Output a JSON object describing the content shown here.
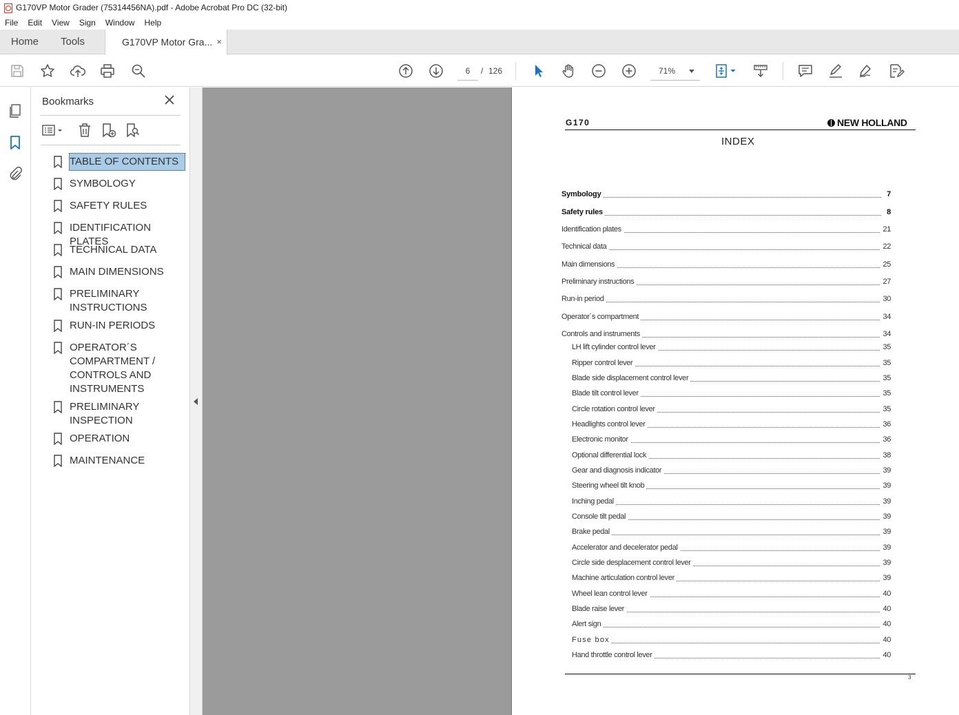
{
  "window": {
    "title": "G170VP Motor Grader (75314456NA).pdf - Adobe Acrobat Pro DC (32-bit)"
  },
  "menu": {
    "items": [
      "File",
      "Edit",
      "View",
      "Sign",
      "Window",
      "Help"
    ]
  },
  "tabs": {
    "home": "Home",
    "tools": "Tools",
    "document": "G170VP Motor Gra...",
    "close_glyph": "×"
  },
  "toolbar": {
    "page_current": "6",
    "page_separator": "/",
    "page_total": "126",
    "zoom": "71%",
    "icons": [
      "save-icon",
      "star-icon",
      "upload-icon",
      "print-icon",
      "search-zoom-icon",
      "page-up-icon",
      "page-down-icon",
      "select-arrow-icon",
      "hand-icon",
      "zoom-out-icon",
      "zoom-in-icon",
      "fit-page-icon",
      "scroll-mode-icon",
      "comment-icon",
      "highlight-icon",
      "sign-icon",
      "edit-pdf-icon"
    ]
  },
  "sidebar": {
    "panel_title": "Bookmarks",
    "close_glyph": "✕",
    "bookmarks": [
      {
        "label": "TABLE OF CONTENTS",
        "selected": true
      },
      {
        "label": "SYMBOLOGY"
      },
      {
        "label": "SAFETY RULES"
      },
      {
        "label": "IDENTIFICATION PLATES"
      },
      {
        "label": "TECHNICAL DATA"
      },
      {
        "label": "MAIN DIMENSIONS"
      },
      {
        "label": "PRELIMINARY INSTRUCTIONS"
      },
      {
        "label": "RUN-IN PERIODS"
      },
      {
        "label": "OPERATOR´S COMPARTMENT / CONTROLS AND INSTRUMENTS"
      },
      {
        "label": "PRELIMINARY INSPECTION"
      },
      {
        "label": "OPERATION"
      },
      {
        "label": "MAINTENANCE"
      }
    ]
  },
  "document": {
    "header_model": "G170",
    "header_brand": "NEW HOLLAND",
    "heading": "INDEX",
    "footer_page": "3",
    "toc": [
      {
        "label": "Symbology",
        "page": "7",
        "style": "bold"
      },
      {
        "label": "Safety  rules",
        "page": "8",
        "style": "bold"
      },
      {
        "label": "Identification plates",
        "page": "21"
      },
      {
        "label": "Technical data",
        "page": "22"
      },
      {
        "label": "Main dimensions",
        "page": "25"
      },
      {
        "label": "Preliminary instructions",
        "page": "27"
      },
      {
        "label": "Run-in period",
        "page": "30"
      },
      {
        "label": "Operator´s compartment",
        "page": "34"
      },
      {
        "label": "Controls and instruments",
        "page": "34"
      },
      {
        "label": "LH lift cylinder control lever",
        "page": "35",
        "style": "sub"
      },
      {
        "label": "Ripper control lever",
        "page": "35",
        "style": "sub"
      },
      {
        "label": "Blade side displacement control lever",
        "page": "35",
        "style": "sub"
      },
      {
        "label": "Blade tilt control lever",
        "page": "35",
        "style": "sub"
      },
      {
        "label": "Circle rotation control lever",
        "page": "35",
        "style": "sub"
      },
      {
        "label": "Headlights control lever",
        "page": "36",
        "style": "sub"
      },
      {
        "label": "Electronic monitor",
        "page": "36",
        "style": "sub"
      },
      {
        "label": "Optional differential lock",
        "page": "38",
        "style": "sub"
      },
      {
        "label": "Gear and diagnosis indicator",
        "page": "39",
        "style": "sub"
      },
      {
        "label": "Steering wheel tilt knob",
        "page": "39",
        "style": "sub"
      },
      {
        "label": "Inching pedal",
        "page": "39",
        "style": "sub"
      },
      {
        "label": "Console tilt pedal",
        "page": "39",
        "style": "sub"
      },
      {
        "label": "Brake pedal",
        "page": "39",
        "style": "sub"
      },
      {
        "label": "Accelerator and decelerator pedal",
        "page": "39",
        "style": "sub"
      },
      {
        "label": "Circle side desplacement control lever",
        "page": "39",
        "style": "sub"
      },
      {
        "label": "Machine articulation control lever",
        "page": "39",
        "style": "sub"
      },
      {
        "label": "Wheel lean control lever",
        "page": "40",
        "style": "sub"
      },
      {
        "label": "Blade raise lever",
        "page": "40",
        "style": "sub"
      },
      {
        "label": "Alert sign",
        "page": "40",
        "style": "sub"
      },
      {
        "label": "Fuse box",
        "page": "40",
        "style": "sub spaced"
      },
      {
        "label": "Hand throttle control lever",
        "page": "40",
        "style": "sub"
      }
    ]
  }
}
